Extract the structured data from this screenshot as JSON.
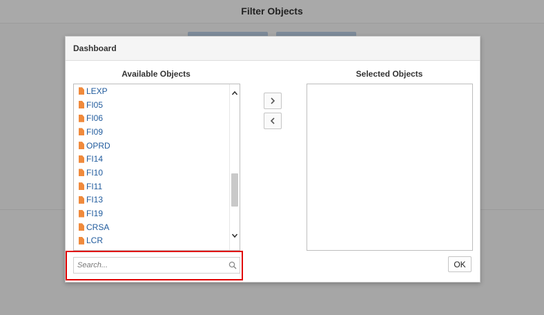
{
  "page": {
    "title": "Filter Objects"
  },
  "dialog": {
    "title": "Dashboard",
    "available_label": "Available Objects",
    "selected_label": "Selected Objects",
    "available_items": [
      "LEXP",
      "FI05",
      "FI06",
      "FI09",
      "OPRD",
      "FI14",
      "FI10",
      "FI11",
      "FI13",
      "FI19",
      "CRSA",
      "LCR"
    ],
    "selected_items": [],
    "move_right_icon": "chevron-right-icon",
    "move_left_icon": "chevron-left-icon",
    "search": {
      "placeholder": "Search...",
      "value": ""
    },
    "ok_label": "OK"
  },
  "colors": {
    "link": "#1f5a9c",
    "file_icon": "#f08a3c",
    "highlight": "#e00000",
    "overlay": "#a6a6a6"
  }
}
